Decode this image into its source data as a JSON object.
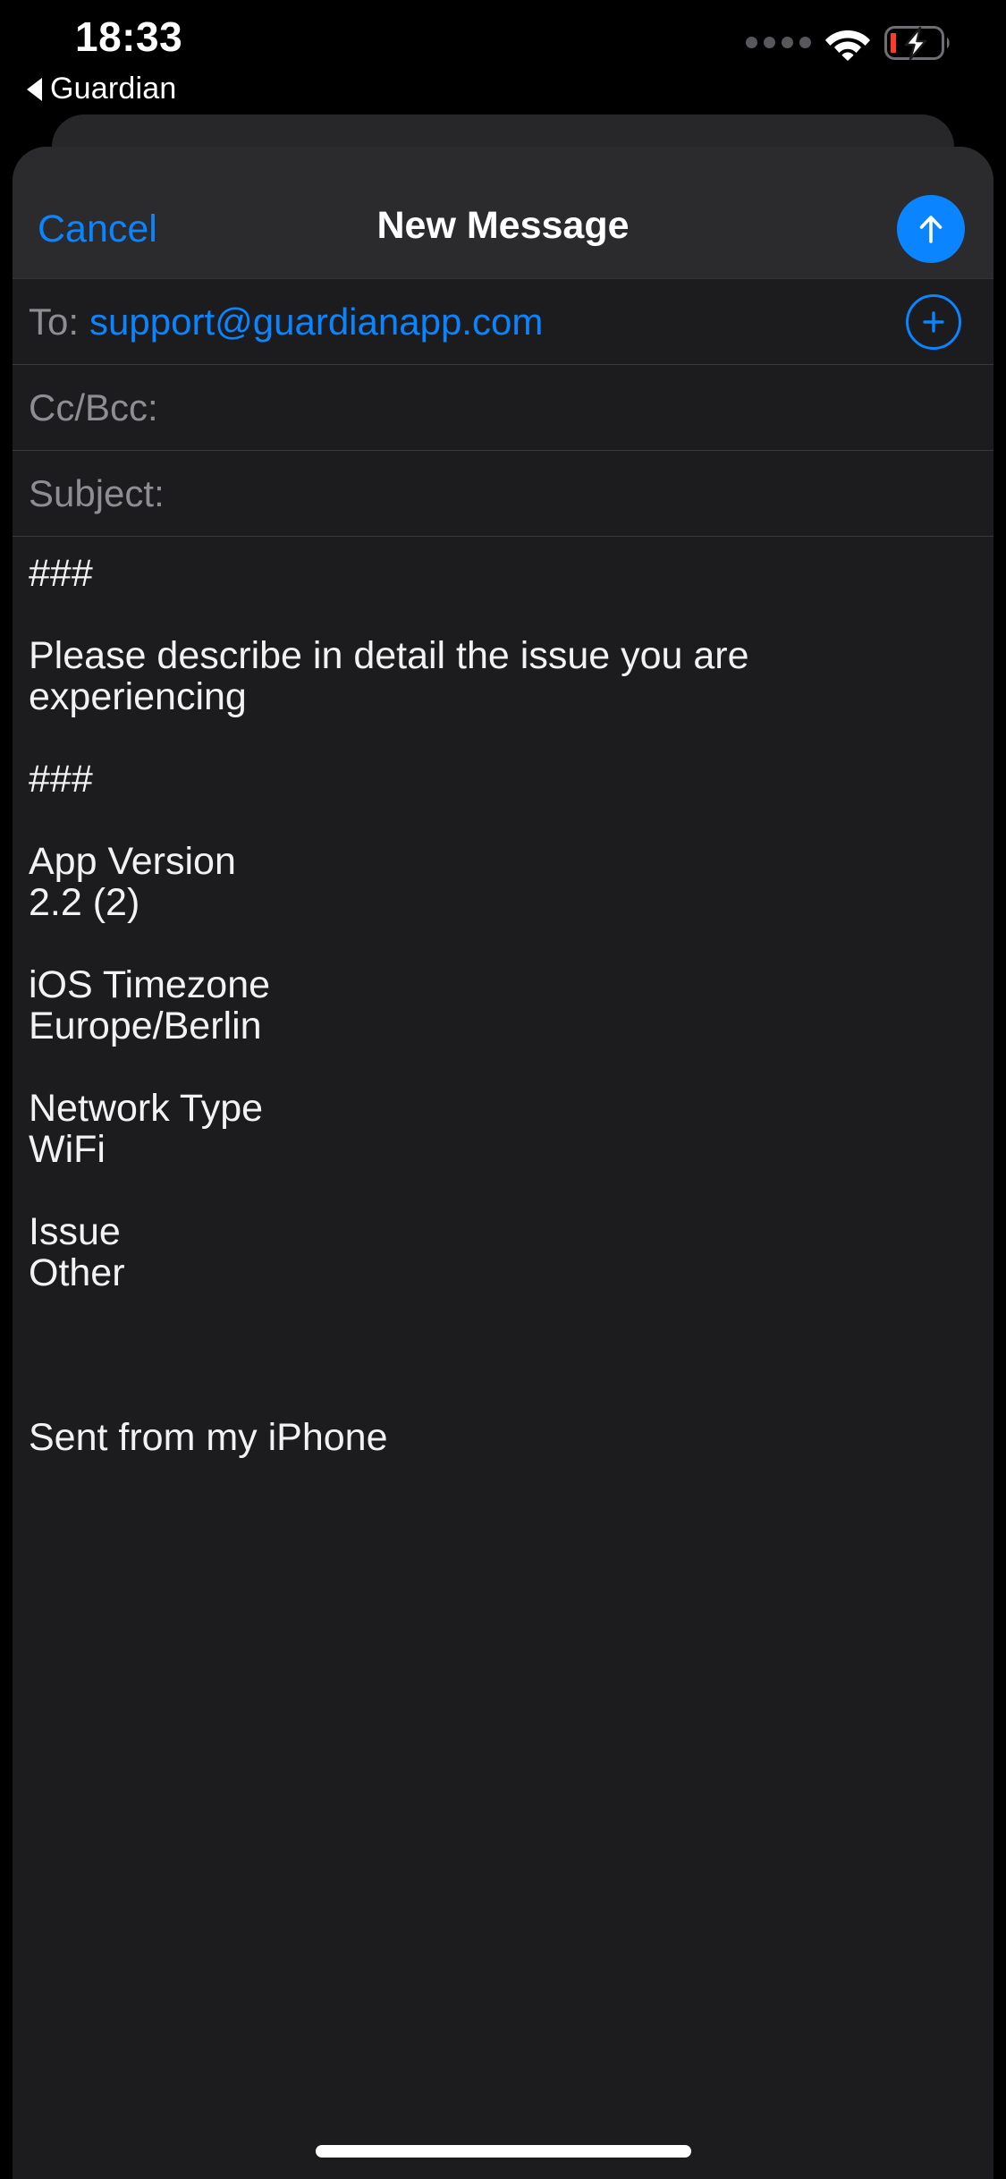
{
  "status_bar": {
    "time": "18:33",
    "signal_dots_icon": "signal-dots-icon",
    "wifi_icon": "wifi-icon",
    "battery_icon": "battery-charging-icon",
    "battery_level_color": "#ff3b30",
    "battery_charging": true
  },
  "back_nav": {
    "arrow_icon": "back-triangle-icon",
    "label": "Guardian"
  },
  "sheet": {
    "grabber_icon": "sheet-grabber-icon"
  },
  "nav_bar": {
    "cancel_label": "Cancel",
    "title": "New Message",
    "send_icon": "send-arrow-up-icon",
    "accent_color": "#0a84ff"
  },
  "fields": {
    "to": {
      "label": "To:",
      "value": "support@guardianapp.com",
      "add_icon": "plus-circle-icon"
    },
    "ccbcc": {
      "label": "Cc/Bcc:",
      "value": ""
    },
    "subject": {
      "label": "Subject:",
      "value": ""
    }
  },
  "body": {
    "divider_top": "###",
    "prompt": "Please describe in detail the issue you are experiencing",
    "divider_bottom": "###",
    "info": [
      {
        "key": "App Version",
        "value": "2.2 (2)"
      },
      {
        "key": "iOS Timezone",
        "value": "Europe/Berlin"
      },
      {
        "key": "Network Type",
        "value": "WiFi"
      },
      {
        "key": "Issue",
        "value": "Other"
      }
    ],
    "signature": "Sent from my iPhone"
  },
  "home_indicator": "home-indicator"
}
